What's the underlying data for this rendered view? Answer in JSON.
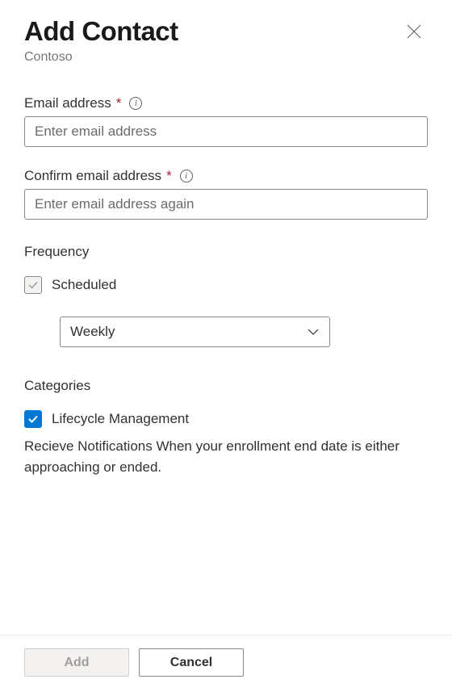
{
  "header": {
    "title": "Add Contact",
    "subtitle": "Contoso"
  },
  "fields": {
    "email": {
      "label": "Email address",
      "placeholder": "Enter email address",
      "required_marker": "*",
      "value": ""
    },
    "confirm_email": {
      "label": "Confirm email address",
      "placeholder": "Enter email address again",
      "required_marker": "*",
      "value": ""
    }
  },
  "frequency": {
    "section_label": "Frequency",
    "scheduled_label": "Scheduled",
    "scheduled_checked": true,
    "scheduled_disabled": true,
    "select_value": "Weekly"
  },
  "categories": {
    "section_label": "Categories",
    "lifecycle": {
      "label": "Lifecycle Management",
      "checked": true,
      "description": "Recieve Notifications When your enrollment end date is either approaching or ended."
    }
  },
  "footer": {
    "add_label": "Add",
    "add_disabled": true,
    "cancel_label": "Cancel"
  },
  "colors": {
    "accent": "#0078d4",
    "required": "#a4262c"
  }
}
